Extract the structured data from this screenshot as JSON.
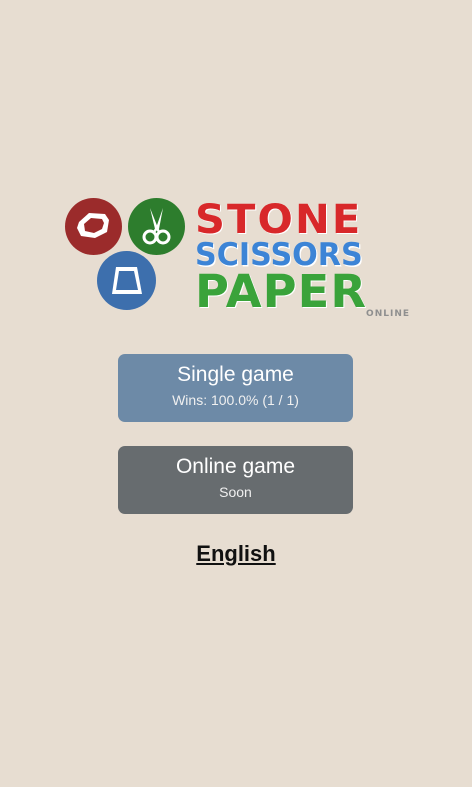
{
  "logo": {
    "word_stone": "STONE",
    "word_scissors": "SCISSORS",
    "word_paper": "PAPER",
    "word_online": "ONLINE",
    "colors": {
      "stone": "#d8282a",
      "scissors": "#3c84d6",
      "paper": "#3aa33a"
    }
  },
  "menu": {
    "single_game": {
      "title": "Single game",
      "subtitle": "Wins: 100.0% (1 / 1)"
    },
    "online_game": {
      "title": "Online game",
      "subtitle": "Soon"
    }
  },
  "language": {
    "label": "English"
  },
  "icons": {
    "stone": "stone-icon",
    "scissors": "scissors-icon",
    "paper": "paper-icon"
  }
}
